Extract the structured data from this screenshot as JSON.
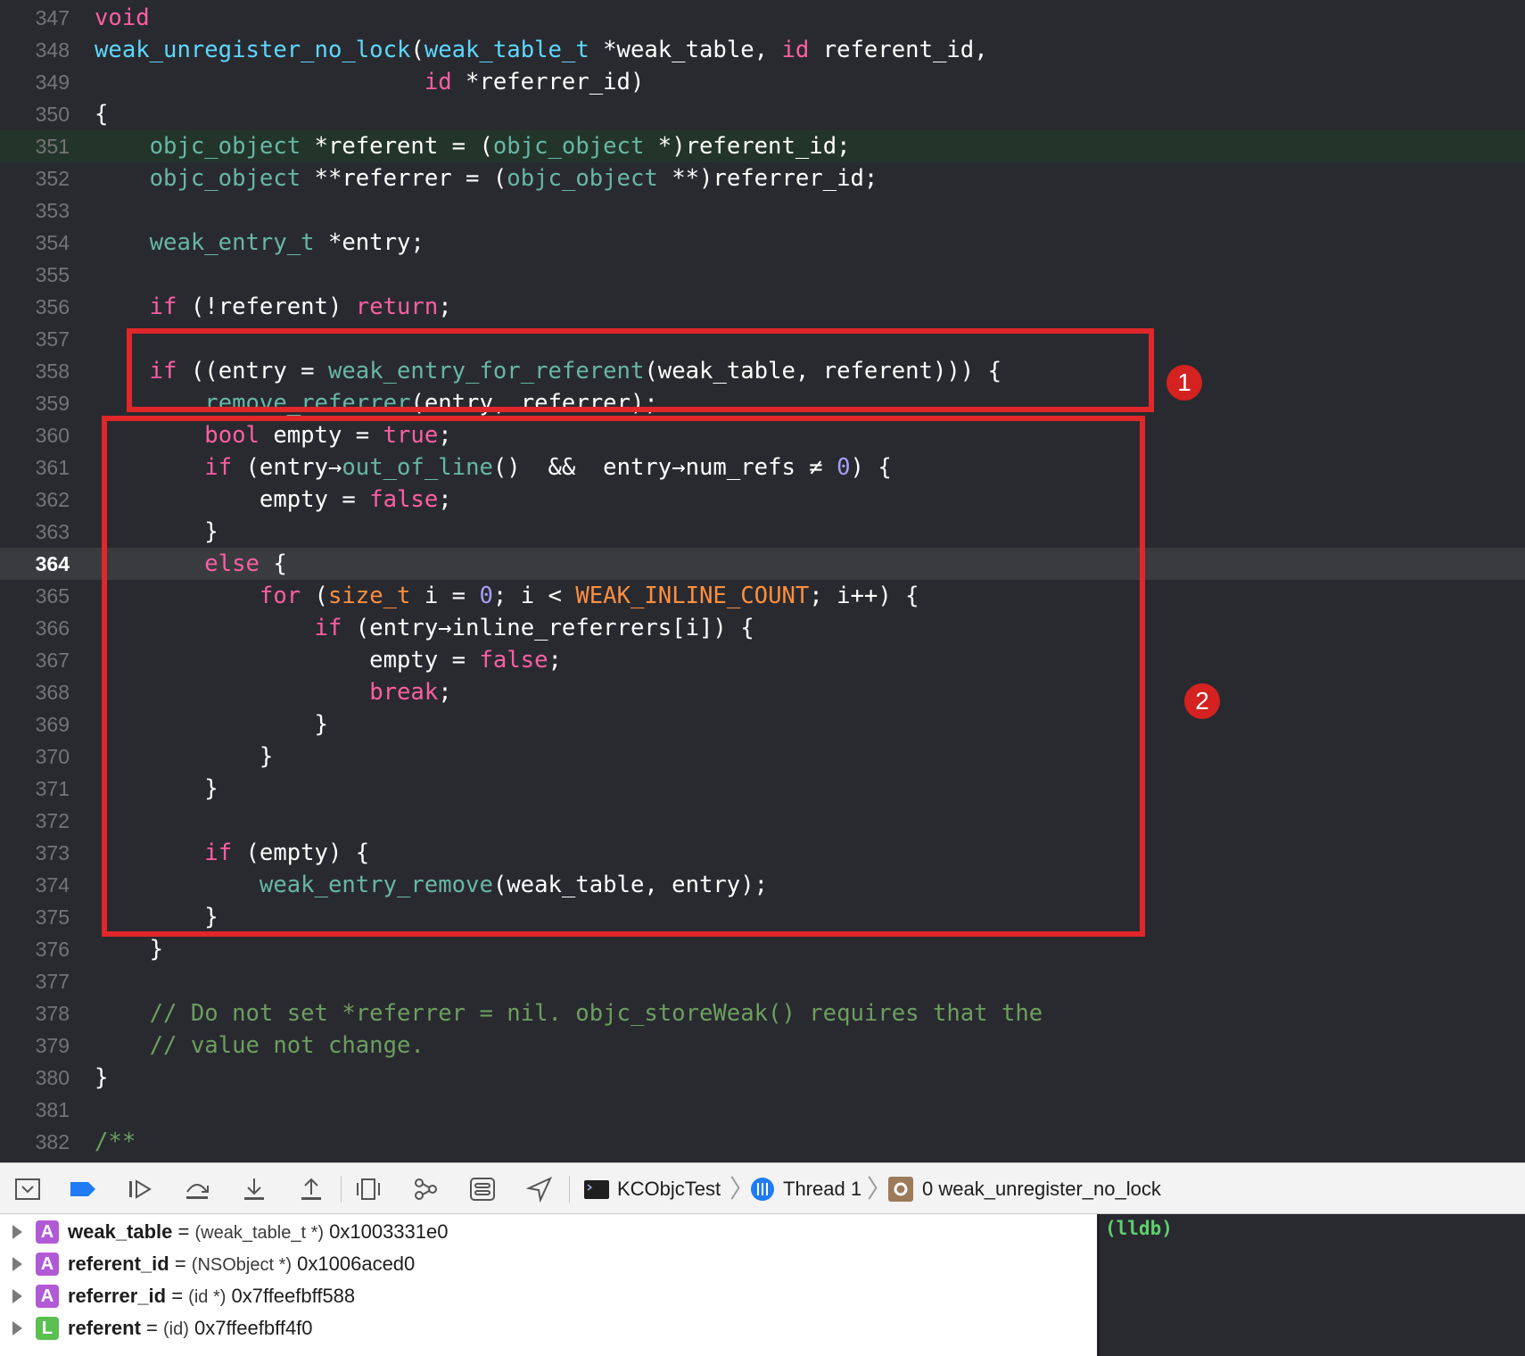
{
  "editor": {
    "lines": [
      {
        "n": "347",
        "tokens": [
          [
            "keyword",
            "void"
          ]
        ]
      },
      {
        "n": "348",
        "tokens": [
          [
            "fn",
            "weak_unregister_no_lock"
          ],
          [
            "plain",
            "("
          ],
          [
            "type",
            "weak_table_t"
          ],
          [
            "plain",
            " *weak_table, "
          ],
          [
            "keyword",
            "id"
          ],
          [
            "plain",
            " referent_id,"
          ]
        ]
      },
      {
        "n": "349",
        "tokens": [
          [
            "plain",
            "                        "
          ],
          [
            "keyword",
            "id"
          ],
          [
            "plain",
            " *referrer_id)"
          ]
        ]
      },
      {
        "n": "350",
        "tokens": [
          [
            "plain",
            "{"
          ]
        ]
      },
      {
        "n": "351",
        "hl": "green",
        "tokens": [
          [
            "plain",
            "    "
          ],
          [
            "local",
            "objc_object"
          ],
          [
            "plain",
            " *referent = ("
          ],
          [
            "local",
            "objc_object"
          ],
          [
            "plain",
            " *)referent_id;"
          ]
        ]
      },
      {
        "n": "352",
        "tokens": [
          [
            "plain",
            "    "
          ],
          [
            "local",
            "objc_object"
          ],
          [
            "plain",
            " **referrer = ("
          ],
          [
            "local",
            "objc_object"
          ],
          [
            "plain",
            " **)referrer_id;"
          ]
        ]
      },
      {
        "n": "353",
        "tokens": []
      },
      {
        "n": "354",
        "tokens": [
          [
            "plain",
            "    "
          ],
          [
            "local",
            "weak_entry_t"
          ],
          [
            "plain",
            " *entry;"
          ]
        ]
      },
      {
        "n": "355",
        "tokens": []
      },
      {
        "n": "356",
        "tokens": [
          [
            "plain",
            "    "
          ],
          [
            "keyword",
            "if"
          ],
          [
            "plain",
            " (!referent) "
          ],
          [
            "keyword",
            "return"
          ],
          [
            "plain",
            ";"
          ]
        ]
      },
      {
        "n": "357",
        "tokens": []
      },
      {
        "n": "358",
        "tokens": [
          [
            "plain",
            "    "
          ],
          [
            "keyword",
            "if"
          ],
          [
            "plain",
            " ((entry = "
          ],
          [
            "local",
            "weak_entry_for_referent"
          ],
          [
            "plain",
            "(weak_table, referent))) {"
          ]
        ]
      },
      {
        "n": "359",
        "tokens": [
          [
            "plain",
            "        "
          ],
          [
            "local",
            "remove_referrer"
          ],
          [
            "plain",
            "(entry, referrer);"
          ]
        ]
      },
      {
        "n": "360",
        "tokens": [
          [
            "plain",
            "        "
          ],
          [
            "keyword",
            "bool"
          ],
          [
            "plain",
            " empty = "
          ],
          [
            "keyword",
            "true"
          ],
          [
            "plain",
            ";"
          ]
        ]
      },
      {
        "n": "361",
        "tokens": [
          [
            "plain",
            "        "
          ],
          [
            "keyword",
            "if"
          ],
          [
            "plain",
            " (entry→"
          ],
          [
            "local",
            "out_of_line"
          ],
          [
            "plain",
            "()  &&  entry→num_refs ≠ "
          ],
          [
            "num",
            "0"
          ],
          [
            "plain",
            ") {"
          ]
        ]
      },
      {
        "n": "362",
        "tokens": [
          [
            "plain",
            "            empty = "
          ],
          [
            "keyword",
            "false"
          ],
          [
            "plain",
            ";"
          ]
        ]
      },
      {
        "n": "363",
        "tokens": [
          [
            "plain",
            "        }"
          ]
        ]
      },
      {
        "n": "364",
        "hl": "current",
        "tokens": [
          [
            "plain",
            "        "
          ],
          [
            "keyword",
            "else"
          ],
          [
            "plain",
            " {"
          ]
        ]
      },
      {
        "n": "365",
        "tokens": [
          [
            "plain",
            "            "
          ],
          [
            "keyword",
            "for"
          ],
          [
            "plain",
            " ("
          ],
          [
            "macro",
            "size_t"
          ],
          [
            "plain",
            " i = "
          ],
          [
            "num",
            "0"
          ],
          [
            "plain",
            "; i < "
          ],
          [
            "macro",
            "WEAK_INLINE_COUNT"
          ],
          [
            "plain",
            "; i++) {"
          ]
        ]
      },
      {
        "n": "366",
        "tokens": [
          [
            "plain",
            "                "
          ],
          [
            "keyword",
            "if"
          ],
          [
            "plain",
            " (entry→inline_referrers[i]) {"
          ]
        ]
      },
      {
        "n": "367",
        "tokens": [
          [
            "plain",
            "                    empty = "
          ],
          [
            "keyword",
            "false"
          ],
          [
            "plain",
            ";"
          ]
        ]
      },
      {
        "n": "368",
        "tokens": [
          [
            "plain",
            "                    "
          ],
          [
            "keyword",
            "break"
          ],
          [
            "plain",
            ";"
          ]
        ]
      },
      {
        "n": "369",
        "tokens": [
          [
            "plain",
            "                }"
          ]
        ]
      },
      {
        "n": "370",
        "tokens": [
          [
            "plain",
            "            }"
          ]
        ]
      },
      {
        "n": "371",
        "tokens": [
          [
            "plain",
            "        }"
          ]
        ]
      },
      {
        "n": "372",
        "tokens": []
      },
      {
        "n": "373",
        "tokens": [
          [
            "plain",
            "        "
          ],
          [
            "keyword",
            "if"
          ],
          [
            "plain",
            " (empty) {"
          ]
        ]
      },
      {
        "n": "374",
        "tokens": [
          [
            "plain",
            "            "
          ],
          [
            "local",
            "weak_entry_remove"
          ],
          [
            "plain",
            "(weak_table, entry);"
          ]
        ]
      },
      {
        "n": "375",
        "tokens": [
          [
            "plain",
            "        }"
          ]
        ]
      },
      {
        "n": "376",
        "tokens": [
          [
            "plain",
            "    }"
          ]
        ]
      },
      {
        "n": "377",
        "tokens": []
      },
      {
        "n": "378",
        "tokens": [
          [
            "plain",
            "    "
          ],
          [
            "comment",
            "// Do not set *referrer = nil. objc_storeWeak() requires that the"
          ]
        ]
      },
      {
        "n": "379",
        "tokens": [
          [
            "plain",
            "    "
          ],
          [
            "comment",
            "// value not change."
          ]
        ]
      },
      {
        "n": "380",
        "tokens": [
          [
            "plain",
            "}"
          ]
        ]
      },
      {
        "n": "381",
        "tokens": []
      },
      {
        "n": "382",
        "tokens": [
          [
            "comment",
            "/**"
          ]
        ]
      }
    ]
  },
  "annotations": {
    "box1_label": "1",
    "box2_label": "2",
    "color": "#e0272a"
  },
  "debug_bar": {
    "icons": [
      "hide-debug-area-icon",
      "breakpoints-toggle-icon",
      "continue-icon",
      "step-over-icon",
      "step-into-icon",
      "step-out-icon",
      "view-hierarchy-icon",
      "memory-graph-icon",
      "environment-overrides-icon",
      "simulate-location-icon"
    ],
    "process": "KCObjcTest",
    "thread": "Thread 1",
    "frame": "0 weak_unregister_no_lock"
  },
  "variables": [
    {
      "badge": "A",
      "badge_color": "#b05ad6",
      "name": "weak_table",
      "eq": " = ",
      "type": "(weak_table_t *)",
      "value": " 0x1003331e0"
    },
    {
      "badge": "A",
      "badge_color": "#b05ad6",
      "name": "referent_id",
      "eq": " = ",
      "type": "(NSObject *)",
      "value": " 0x1006aced0"
    },
    {
      "badge": "A",
      "badge_color": "#b05ad6",
      "name": "referrer_id",
      "eq": " = ",
      "type": "(id *)",
      "value": " 0x7ffeefbff588"
    },
    {
      "badge": "L",
      "badge_color": "#5bbf52",
      "name": "referent",
      "eq": " = ",
      "type": "(id)",
      "value": " 0x7ffeefbff4f0"
    }
  ],
  "console": {
    "prompt": "(lldb)"
  }
}
